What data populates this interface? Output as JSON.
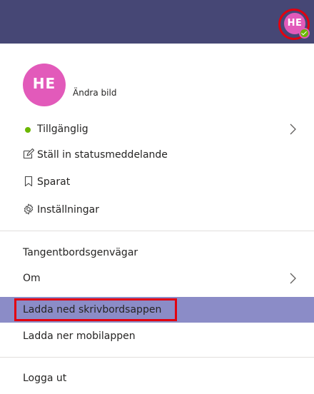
{
  "profile": {
    "initials": "HE",
    "change_picture_label": "Ändra bild"
  },
  "menu": {
    "availability_label": "Tillgänglig",
    "status_message_label": "Ställ in statusmeddelande",
    "saved_label": "Sparat",
    "settings_label": "Inställningar",
    "shortcuts_label": "Tangentbordsgenvägar",
    "about_label": "Om",
    "download_desktop_label": "Ladda ned skrivbordsappen",
    "download_mobile_label": "Ladda ner mobilappen",
    "sign_out_label": "Logga ut"
  },
  "colors": {
    "topbar": "#464775",
    "avatar": "#e25aba",
    "presence_available": "#6bb700",
    "selected_row": "#8b8cc7",
    "highlight_annotation": "#e3000f"
  },
  "icons": {
    "availability": "status-dot-icon",
    "status_message": "edit-message-icon",
    "saved": "bookmark-icon",
    "settings": "gear-icon",
    "submenu": "chevron-right-icon"
  }
}
